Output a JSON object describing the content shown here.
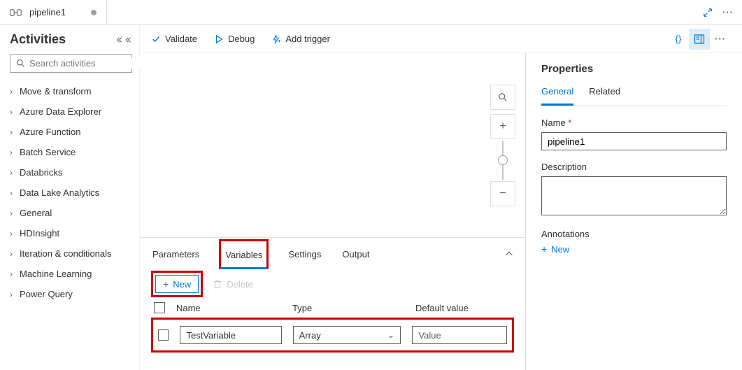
{
  "tab": {
    "title": "pipeline1"
  },
  "activities": {
    "heading": "Activities",
    "search_placeholder": "Search activities",
    "items": [
      "Move & transform",
      "Azure Data Explorer",
      "Azure Function",
      "Batch Service",
      "Databricks",
      "Data Lake Analytics",
      "General",
      "HDInsight",
      "Iteration & conditionals",
      "Machine Learning",
      "Power Query"
    ]
  },
  "toolbar": {
    "validate": "Validate",
    "debug": "Debug",
    "add_trigger": "Add trigger",
    "code_glyph": "{}",
    "more_glyph": "···"
  },
  "bottom": {
    "tabs": [
      "Parameters",
      "Variables",
      "Settings",
      "Output"
    ],
    "active_tab": "Variables",
    "new_label": "New",
    "delete_label": "Delete",
    "headers": {
      "name": "Name",
      "type": "Type",
      "default": "Default value"
    },
    "row": {
      "name": "TestVariable",
      "type": "Array",
      "default_placeholder": "Value"
    }
  },
  "properties": {
    "heading": "Properties",
    "tabs": [
      "General",
      "Related"
    ],
    "active_tab": "General",
    "name_label": "Name",
    "name_value": "pipeline1",
    "description_label": "Description",
    "annotations_label": "Annotations",
    "new_label": "New"
  }
}
